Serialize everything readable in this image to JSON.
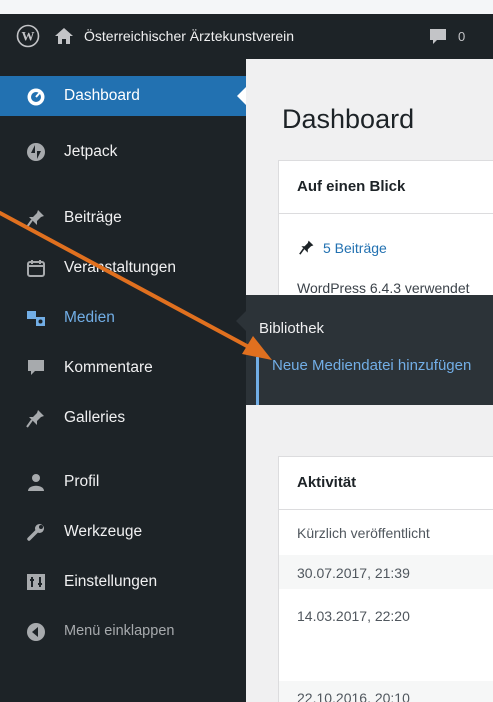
{
  "adminbar": {
    "site_name": "Österreichischer Ärztekunstverein",
    "comment_count": "0"
  },
  "sidebar": {
    "items": [
      {
        "label": "Dashboard",
        "icon": "dashboard-icon",
        "current": true
      },
      {
        "label": "Jetpack",
        "icon": "jetpack-icon"
      },
      {
        "label": "Beiträge",
        "icon": "pin-icon"
      },
      {
        "label": "Veranstaltungen",
        "icon": "calendar-icon"
      },
      {
        "label": "Medien",
        "icon": "media-icon",
        "hover": true
      },
      {
        "label": "Kommentare",
        "icon": "comment-icon"
      },
      {
        "label": "Galleries",
        "icon": "pin-icon"
      },
      {
        "label": "Profil",
        "icon": "user-icon"
      },
      {
        "label": "Werkzeuge",
        "icon": "wrench-icon"
      },
      {
        "label": "Einstellungen",
        "icon": "settings-icon"
      },
      {
        "label": "Menü einklappen",
        "icon": "collapse-icon"
      }
    ]
  },
  "flyout": {
    "title": "Bibliothek",
    "link": "Neue Mediendatei hinzufügen"
  },
  "main": {
    "title": "Dashboard",
    "glance": {
      "header": "Auf einen Blick",
      "posts_link": "5 Beiträge",
      "version_text": "WordPress 6.4.3 verwendet"
    },
    "activity": {
      "header": "Aktivität",
      "subheader": "Kürzlich veröffentlicht",
      "dates": [
        "30.07.2017, 21:39",
        "14.03.2017, 22:20",
        "22.10.2016, 20:10"
      ]
    }
  },
  "colors": {
    "admin_bg": "#1d2327",
    "highlight": "#2271b1",
    "link_hover": "#72aee6",
    "annotation_arrow": "#e0701f"
  }
}
